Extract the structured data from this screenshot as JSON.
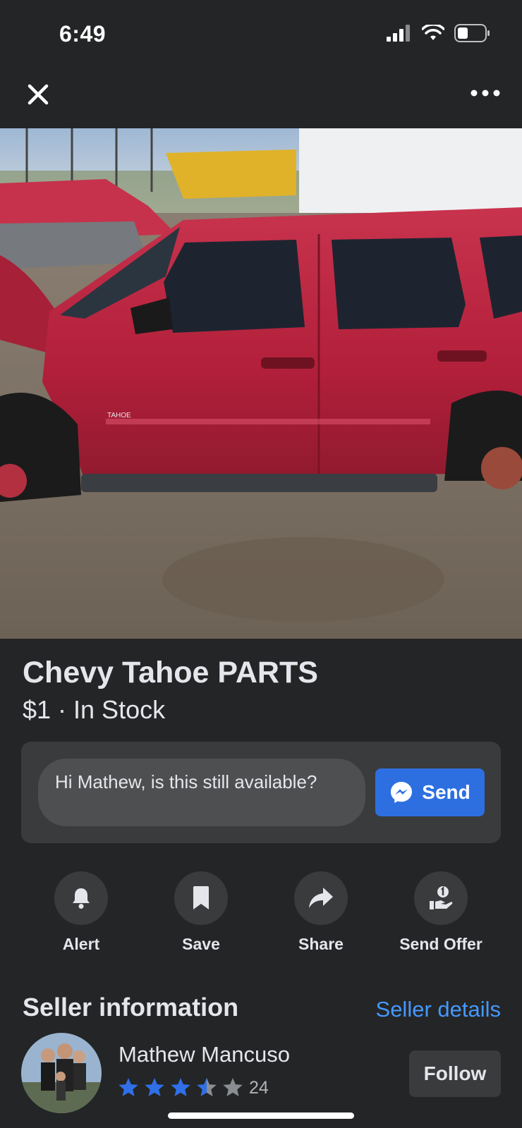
{
  "status_bar": {
    "time": "6:49",
    "icons": [
      "signal-icon",
      "wifi-icon",
      "battery-icon"
    ]
  },
  "top_bar": {
    "close_icon": "close-icon",
    "more_icon": "more-icon"
  },
  "listing": {
    "photo_description_icon": "listing-photo",
    "title": "Chevy Tahoe PARTS",
    "price_line": "$1 · In Stock"
  },
  "message": {
    "input_text": "Hi Mathew, is this still available?",
    "send_label": "Send",
    "send_icon": "messenger-icon"
  },
  "actions": [
    {
      "label": "Alert",
      "icon": "bell-icon"
    },
    {
      "label": "Save",
      "icon": "bookmark-icon"
    },
    {
      "label": "Share",
      "icon": "share-icon"
    },
    {
      "label": "Send Offer",
      "icon": "offer-icon"
    }
  ],
  "seller": {
    "heading": "Seller information",
    "details_link": "Seller details",
    "name": "Mathew Mancuso",
    "rating_value": 3.5,
    "rating_max": 5,
    "rating_count": "24",
    "follow_label": "Follow"
  },
  "colors": {
    "background": "#242526",
    "card": "#3a3b3c",
    "accent": "#2d6fe0",
    "link": "#4599ff",
    "star": "#2f6fe8"
  }
}
